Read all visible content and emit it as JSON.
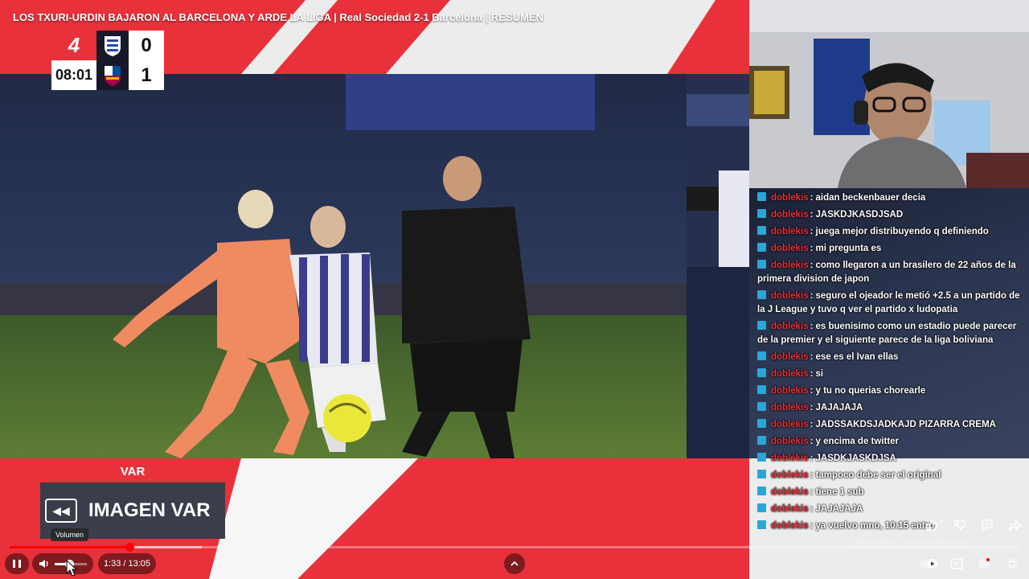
{
  "video": {
    "title": "LOS TXURI-URDIN BAJARON AL BARCELONA Y ARDE LA LIGA | Real Sociedad 2-1 Barcelona | RESUMEN"
  },
  "scoreboard": {
    "league_logo": "4",
    "clock": "08:01",
    "home_score": "0",
    "away_score": "1",
    "home_crest_icon": "real-sociedad-crest-icon",
    "away_crest_icon": "barcelona-crest-icon"
  },
  "chat": {
    "messages": [
      {
        "user": "doblekis",
        "text": "aidan beckenbauer decia"
      },
      {
        "user": "doblekis",
        "text": "JASKDJKASDJSAD"
      },
      {
        "user": "doblekis",
        "text": "juega mejor distribuyendo q definiendo"
      },
      {
        "user": "doblekis",
        "text": "mi pregunta es"
      },
      {
        "user": "doblekis",
        "text": "como llegaron a un brasilero de 22 años de la primera division de japon"
      },
      {
        "user": "doblekis",
        "text": "seguro el ojeador le metió +2.5 a un partido de la J League y tuvo q ver el partido x ludopatia"
      },
      {
        "user": "doblekis",
        "text": "es buenisimo como un estadio puede parecer de la premier y el siguiente parece de la liga boliviana"
      },
      {
        "user": "doblekis",
        "text": "ese es el Ivan ellas"
      },
      {
        "user": "doblekis",
        "text": "si"
      },
      {
        "user": "doblekis",
        "text": "y tu no querias chorearle"
      },
      {
        "user": "doblekis",
        "text": "JAJAJAJA"
      },
      {
        "user": "doblekis",
        "text": "JADSSAKDSJADKAJD PIZARRA CREMA"
      },
      {
        "user": "doblekis",
        "text": "y encima de twitter"
      },
      {
        "user": "doblekis",
        "text": "JASDKJASKDJSA"
      },
      {
        "user": "doblekis",
        "text": "tampoco debe ser el original"
      },
      {
        "user": "doblekis",
        "text": "tiene 1 sub"
      },
      {
        "user": "doblekis",
        "text": "JAJAJAJA"
      },
      {
        "user": "doblekis",
        "text": "ya vuelvo mno, 10:15 entro"
      }
    ]
  },
  "var_graphic": {
    "tab_label": "VAR",
    "main_label": "IMAGEN VAR",
    "icon": "rewind-icon"
  },
  "player": {
    "current_time": "1:33",
    "duration": "13:05",
    "time_display": "1:33 / 13:05",
    "progress": 0.1185,
    "buffered": 0.19,
    "volume": 0.45,
    "volume_tooltip": "Volumen",
    "watermark": "#RealSociedadBarça"
  },
  "colors": {
    "accent_red": "#e8313a",
    "progress_red": "#ff0000",
    "chat_badge": "#2aa6d8"
  }
}
